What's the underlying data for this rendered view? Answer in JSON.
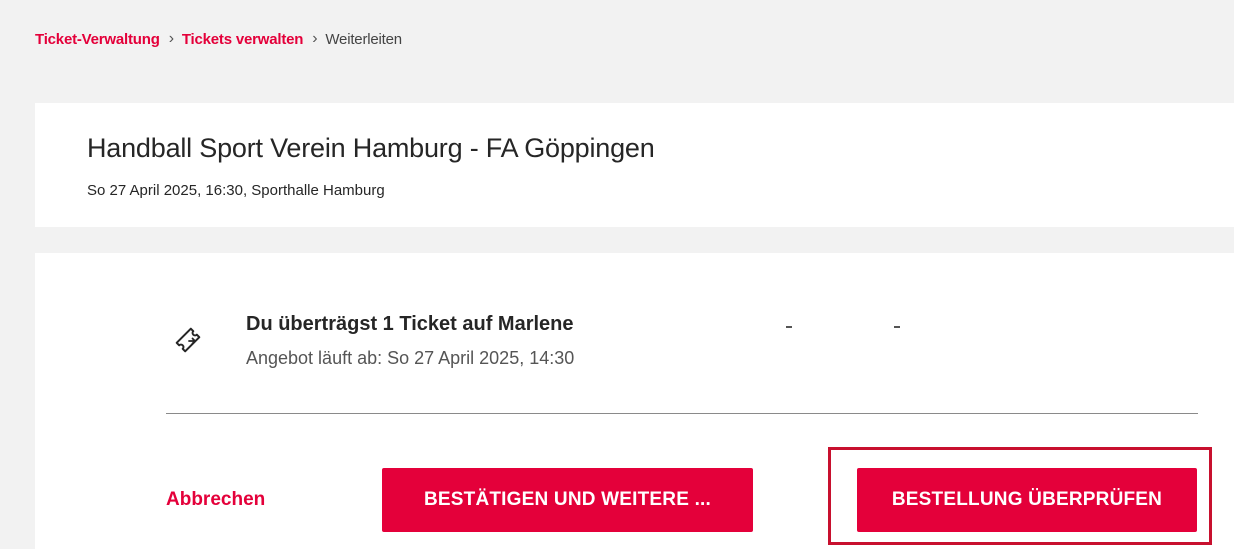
{
  "breadcrumb": {
    "items": [
      "Ticket-Verwaltung",
      "Tickets verwalten"
    ],
    "current": "Weiterleiten",
    "separator": "›"
  },
  "event": {
    "title": "Handball Sport Verein Hamburg - FA Göppingen",
    "details": "So 27 April 2025, 16:30, Sporthalle Hamburg"
  },
  "transfer": {
    "icon": "ticket-transfer-icon",
    "title": "Du überträgst 1 Ticket auf Marlene",
    "expiry": "Angebot läuft ab: So 27 April 2025, 14:30"
  },
  "actions": {
    "cancel_label": "Abbrechen",
    "confirm_label": "BESTÄTIGEN UND WEITERE ...",
    "review_label": "BESTELLUNG ÜBERPRÜFEN"
  },
  "colors": {
    "accent": "#e4003a",
    "highlight": "#c8102e",
    "background": "#f2f2f2"
  }
}
